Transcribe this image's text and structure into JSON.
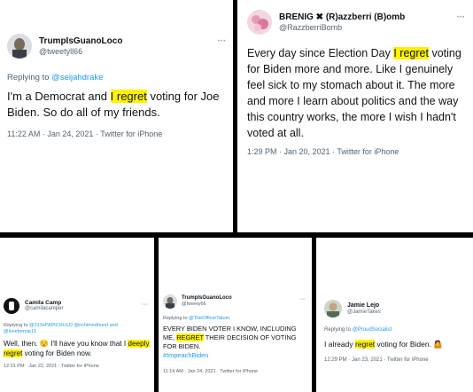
{
  "colors": {
    "highlight": "#fff200",
    "link": "#1d9bf0",
    "muted": "#536471",
    "text": "#0f1419"
  },
  "more_icon": "•••",
  "tweet1": {
    "name": "TrumpIsGuanoLoco",
    "handle": "@tweetyll66",
    "reply_prefix": "Replying to ",
    "reply_to": "@seijahdrake",
    "text_before": "I'm a Democrat and ",
    "highlight": "I regret",
    "text_after": " voting for Joe Biden. So do all of my friends.",
    "meta": "11:22 AM · Jan 24, 2021 · Twitter for iPhone"
  },
  "tweet2": {
    "name": "BRENIG ✖ (R)azzberri (B)omb",
    "handle": "@RazzberriBomb",
    "text_before": "Every day since Election Day ",
    "highlight": "I regret",
    "text_after": " voting for Biden more and more. Like I genuinely feel sick to my stomach about it. The more and more I learn about politics and the way this country works, the more I wish I hadn't voted at all.",
    "meta": "1:29 PM · Jan 20, 2021 · Twitter for iPhone"
  },
  "tweet3": {
    "name": "Camila Camp",
    "handle": "@camilacamper",
    "reply_prefix": "Replying to ",
    "reply_to": "@313sPAPICHULO @richimedhurst and @lovebernie15",
    "text_before": "Well, then. 😒 I'll have you know that I ",
    "highlight": "deeply regret",
    "text_after": " voting for Biden now.",
    "meta": "12:31 PM · Jan 22, 2021 · Twitter for iPhone"
  },
  "tweet4": {
    "name": "TrumpIsGuanoLoco",
    "handle": "@tweety66",
    "reply_prefix": "Replying to ",
    "reply_to": "@TheOfficerTatum",
    "text_before": "EVERY BIDEN VOTER I KNOW, INCLUDING ME, ",
    "highlight": "REGRET",
    "text_after": " THEIR DECISION OF VOTING FOR BIDEN.",
    "hashtag": "#ImpeachBiden",
    "meta": "11:14 AM · Jan 24, 2021 · Twitter for iPhone"
  },
  "tweet5": {
    "name": "Jamie Lejo",
    "handle": "@JamieTakes",
    "reply_prefix": "Replying to ",
    "reply_to": "@ProudSocialist",
    "text_before": "I already ",
    "highlight": "regret",
    "text_after": " voting for Biden. 🤷",
    "meta": "12:29 PM · Jan 23, 2021 · Twitter for iPhone"
  }
}
